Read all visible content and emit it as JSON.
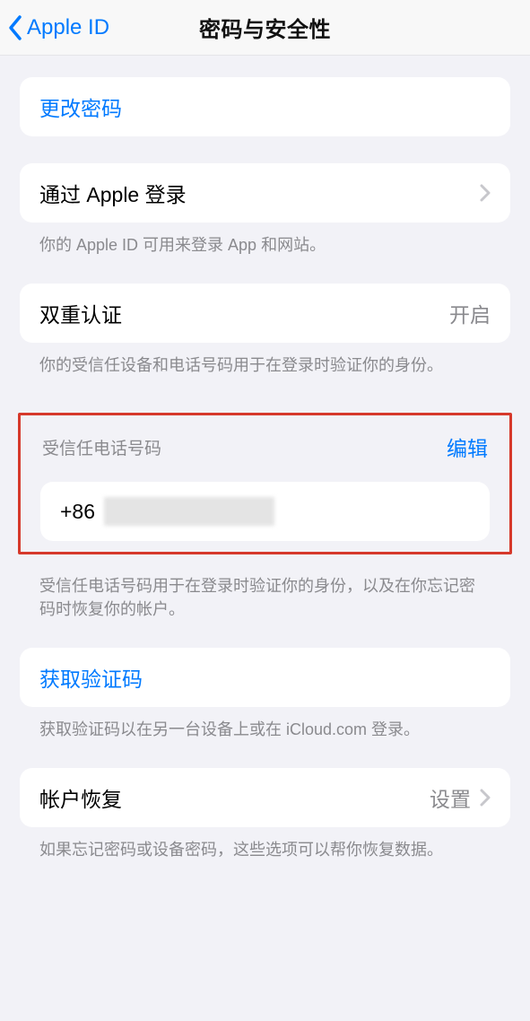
{
  "nav": {
    "back_label": "Apple ID",
    "title": "密码与安全性"
  },
  "change_password": {
    "label": "更改密码"
  },
  "sign_in_apple": {
    "label": "通过 Apple 登录",
    "footer": "你的 Apple ID 可用来登录 App 和网站。"
  },
  "two_factor": {
    "label": "双重认证",
    "value": "开启",
    "footer": "你的受信任设备和电话号码用于在登录时验证你的身份。"
  },
  "trusted_phone": {
    "header": "受信任电话号码",
    "edit": "编辑",
    "prefix": "+86",
    "footer": "受信任电话号码用于在登录时验证你的身份，以及在你忘记密码时恢复你的帐户。"
  },
  "get_code": {
    "label": "获取验证码",
    "footer": "获取验证码以在另一台设备上或在 iCloud.com 登录。"
  },
  "account_recovery": {
    "label": "帐户恢复",
    "value": "设置",
    "footer": "如果忘记密码或设备密码，这些选项可以帮你恢复数据。"
  }
}
